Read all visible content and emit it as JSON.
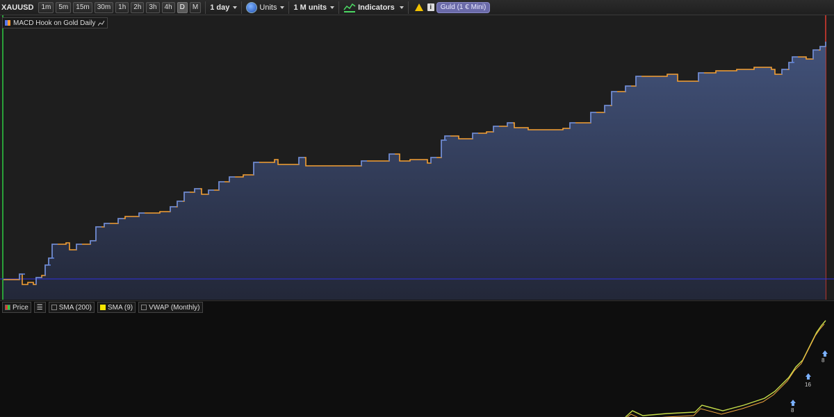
{
  "toolbar": {
    "symbol": "XAUUSD",
    "timeframes": [
      "1m",
      "5m",
      "15m",
      "30m",
      "1h",
      "2h",
      "3h",
      "4h",
      "D",
      "M"
    ],
    "active_timeframe": "D",
    "period": "1 day",
    "units_label": "Units",
    "size": "1 M units",
    "indicators": "Indicators",
    "instrument_badge": "Guld (1 € Mini)"
  },
  "panel_top": {
    "legend": "MACD Hook on Gold Daily"
  },
  "panel_bottom": {
    "legend_items": [
      "Price",
      "SMA (200)",
      "SMA (9)",
      "VWAP (Monthly)"
    ],
    "trade_labels": [
      "8",
      "16",
      "8"
    ]
  },
  "colors": {
    "line_blue": "#5b86e5",
    "line_orange": "#f5a033",
    "area_fill": "#3b4c74",
    "vline_left": "#2ecc40",
    "vline_right": "#e03c31",
    "baseline": "#2a2aff"
  }
}
